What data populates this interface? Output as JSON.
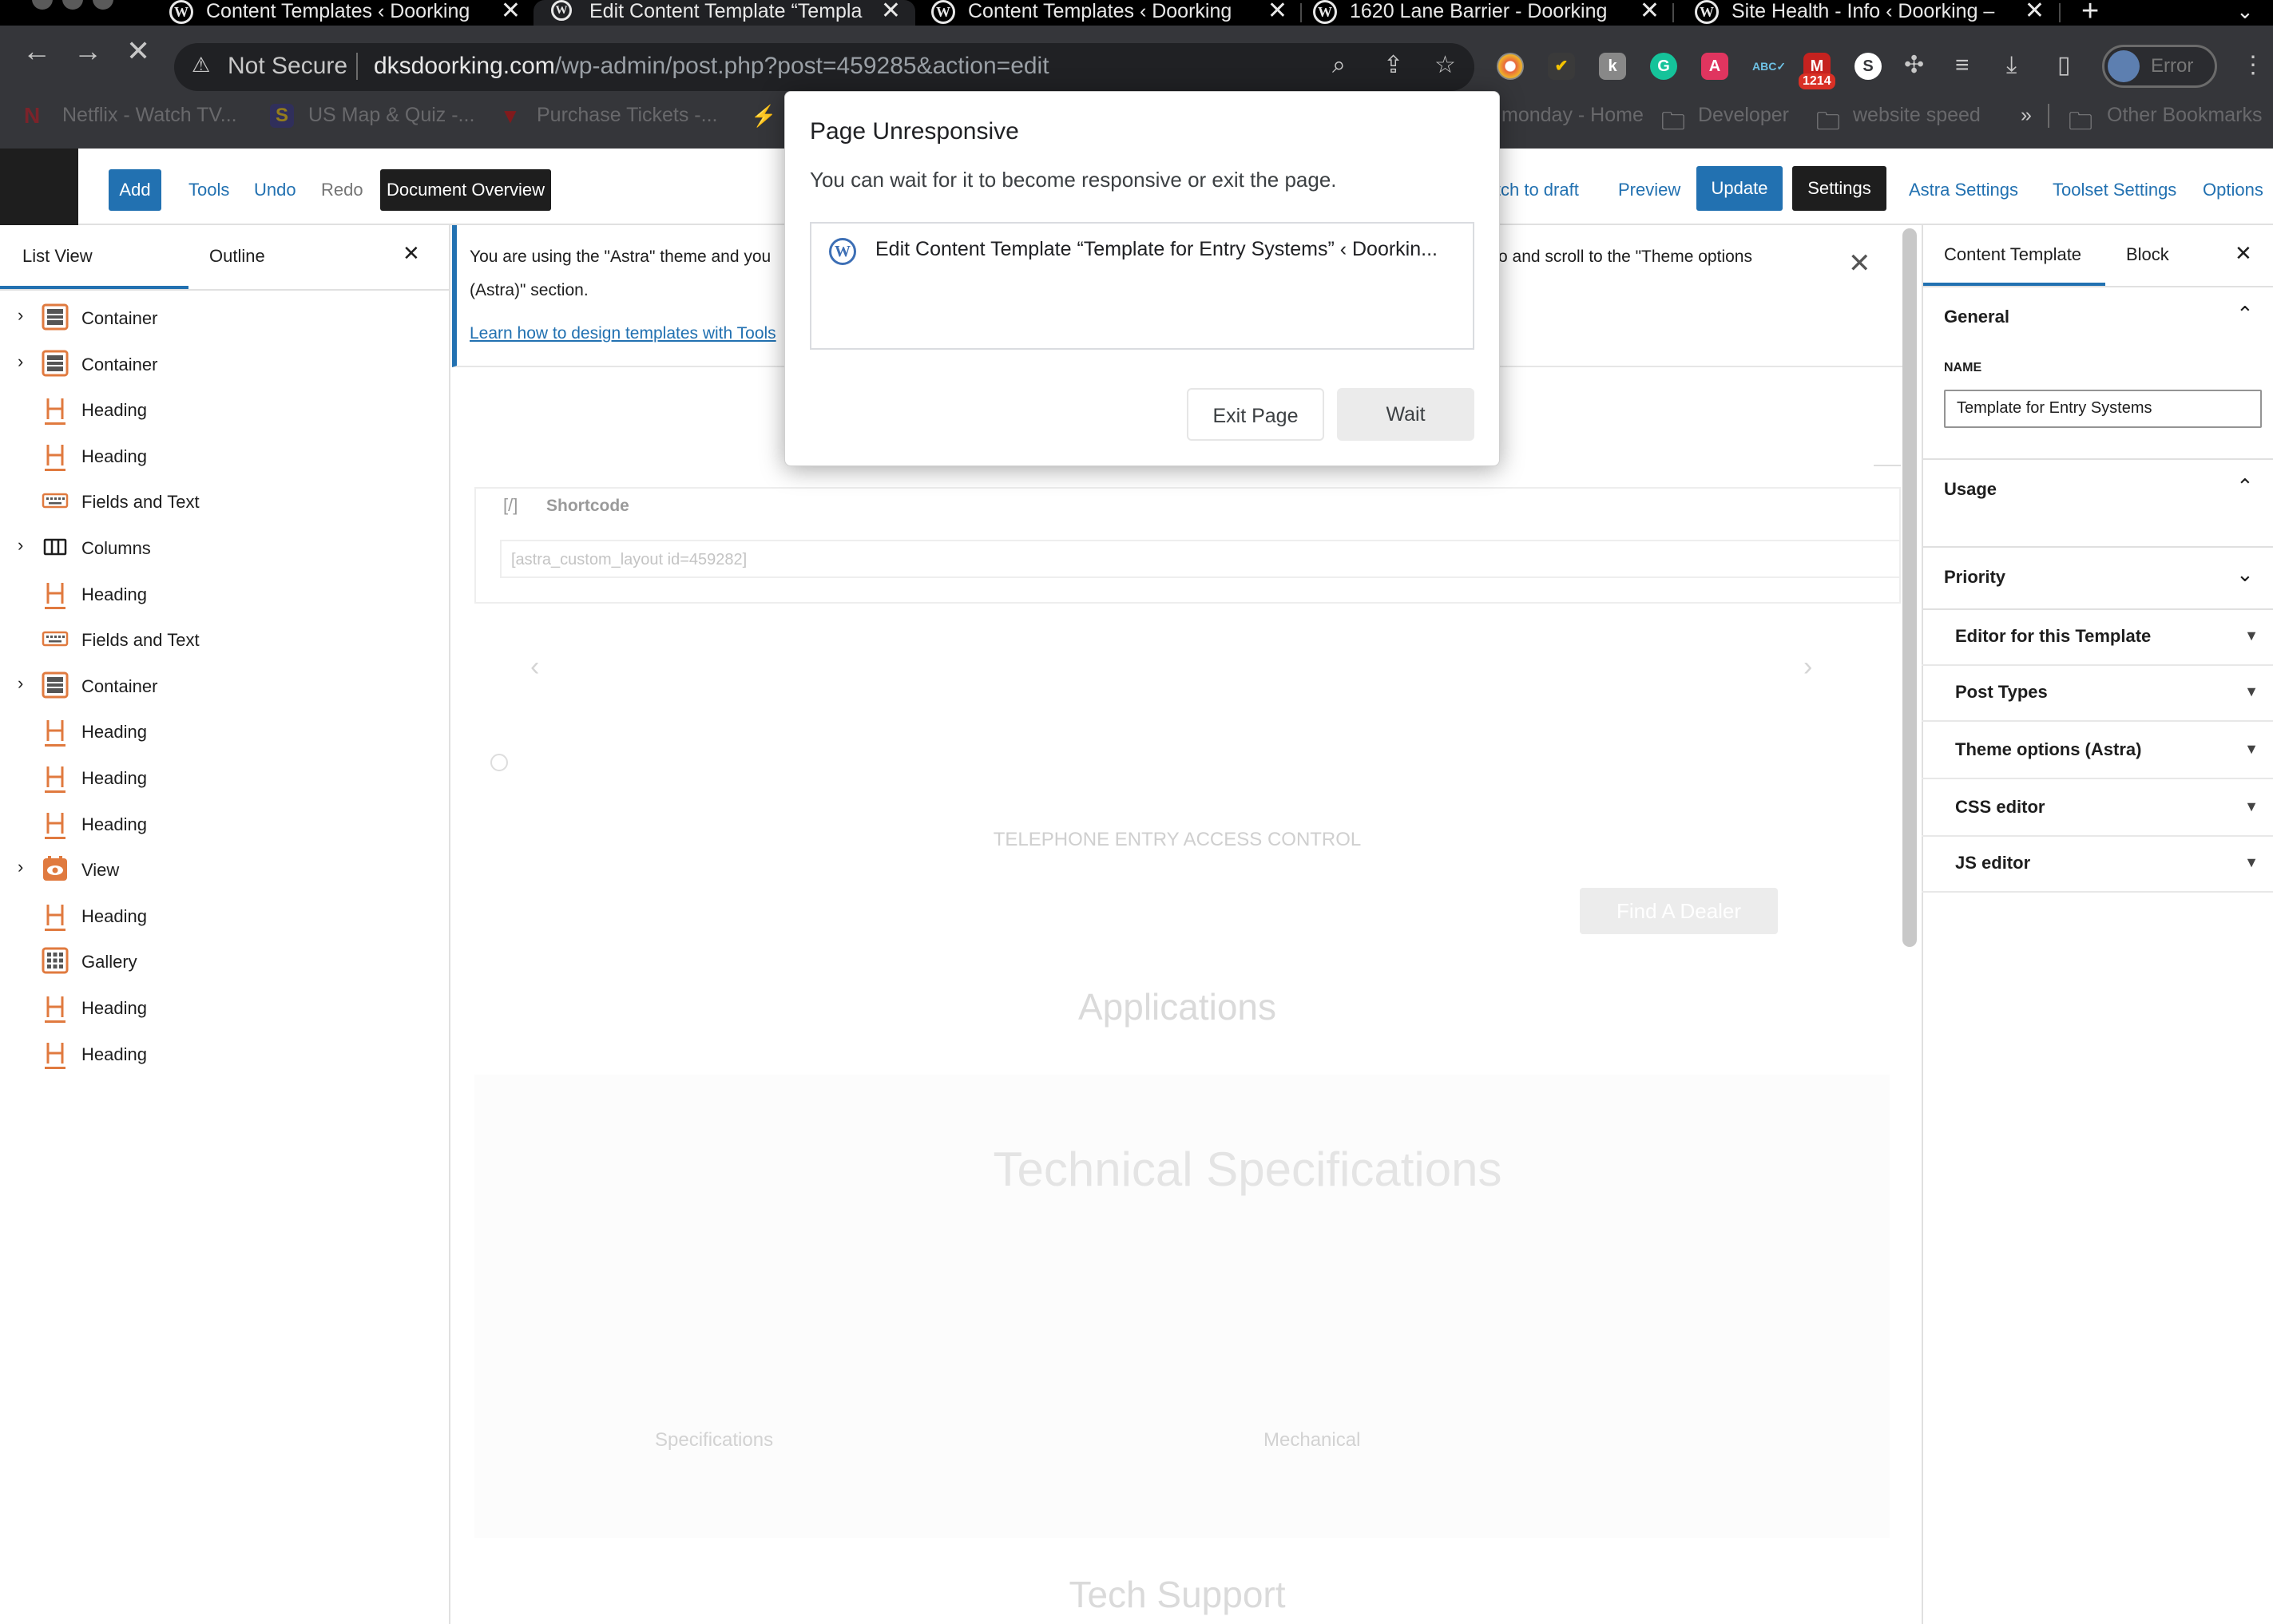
{
  "browser": {
    "tabs": [
      {
        "title": "Content Templates ‹ Doorking",
        "active": false
      },
      {
        "title": "Edit Content Template “Templa",
        "active": true
      },
      {
        "title": "Content Templates ‹ Doorking",
        "active": false
      },
      {
        "title": "1620 Lane Barrier - Doorking",
        "active": false
      },
      {
        "title": "Site Health - Info ‹ Doorking –",
        "active": false
      }
    ],
    "new_tab": "+",
    "security_label": "Not Secure",
    "url_domain": "dksdoorking.com",
    "url_path": "/wp-admin/post.php?post=459285&action=edit",
    "gmail_count": "1214",
    "profile_name": "Error",
    "bookmarks": [
      "Netflix - Watch TV...",
      "US Map & Quiz -...",
      "Purchase Tickets -...",
      "monday - Home",
      "Developer",
      "website speed",
      "»",
      "Other Bookmarks"
    ]
  },
  "toolbar": {
    "add": "Add",
    "tools": "Tools",
    "undo": "Undo",
    "redo": "Redo",
    "document_overview": "Document Overview",
    "switch_to_draft": "itch to draft",
    "preview": "Preview",
    "update": "Update",
    "settings": "Settings",
    "astra_settings": "Astra Settings",
    "toolset_settings": "Toolset Settings",
    "options": "Options"
  },
  "list_view": {
    "tab_list": "List View",
    "tab_outline": "Outline",
    "items": [
      {
        "label": "Container",
        "icon": "container-icon",
        "expandable": true
      },
      {
        "label": "Container",
        "icon": "container-icon",
        "expandable": true
      },
      {
        "label": "Heading",
        "icon": "heading-icon",
        "expandable": false
      },
      {
        "label": "Heading",
        "icon": "heading-icon",
        "expandable": false
      },
      {
        "label": "Fields and Text",
        "icon": "keyboard-icon",
        "expandable": false
      },
      {
        "label": "Columns",
        "icon": "columns-icon",
        "expandable": true
      },
      {
        "label": "Heading",
        "icon": "heading-icon",
        "expandable": false
      },
      {
        "label": "Fields and Text",
        "icon": "keyboard-icon",
        "expandable": false
      },
      {
        "label": "Container",
        "icon": "container-icon",
        "expandable": true
      },
      {
        "label": "Heading",
        "icon": "heading-icon",
        "expandable": false
      },
      {
        "label": "Heading",
        "icon": "heading-icon",
        "expandable": false
      },
      {
        "label": "Heading",
        "icon": "heading-icon",
        "expandable": false
      },
      {
        "label": "View",
        "icon": "view-icon",
        "expandable": true
      },
      {
        "label": "Heading",
        "icon": "heading-icon",
        "expandable": false
      },
      {
        "label": "Gallery",
        "icon": "gallery-icon",
        "expandable": false
      },
      {
        "label": "Heading",
        "icon": "heading-icon",
        "expandable": false
      },
      {
        "label": "Heading",
        "icon": "heading-icon",
        "expandable": false
      }
    ]
  },
  "canvas": {
    "notice_line1a": "You are using the \"Astra\" theme and you",
    "notice_line1b": "o and scroll to the \"Theme options",
    "notice_line2": "(Astra)\" section.",
    "notice_link": "Learn how to design templates with Tools",
    "shortcode_label": "Shortcode",
    "shortcode_value": "[astra_custom_layout id=459282]",
    "telephone_heading": "TELEPHONE ENTRY ACCESS CONTROL",
    "find_dealer": "Find A Dealer",
    "applications": "Applications",
    "tech_specs": "Technical Specifications",
    "specifications": "Specifications",
    "mechanical": "Mechanical",
    "tech_support": "Tech Support"
  },
  "settings_panel": {
    "tab_content_template": "Content Template",
    "tab_block": "Block",
    "general": "General",
    "name_label": "NAME",
    "name_value": "Template for Entry Systems",
    "usage": "Usage",
    "priority": "Priority",
    "sections": [
      "Editor for this Template",
      "Post Types",
      "Theme options (Astra)",
      "CSS editor",
      "JS editor"
    ]
  },
  "dialog": {
    "title": "Page Unresponsive",
    "message": "You can wait for it to become responsive or exit the page.",
    "tab_title": "Edit Content Template “Template for Entry Systems” ‹ Doorkin...",
    "exit": "Exit Page",
    "wait": "Wait"
  },
  "colors": {
    "wp_blue": "#2271b1",
    "block_icon_orange": "#e07a3f",
    "chrome_dark": "#35363a"
  }
}
